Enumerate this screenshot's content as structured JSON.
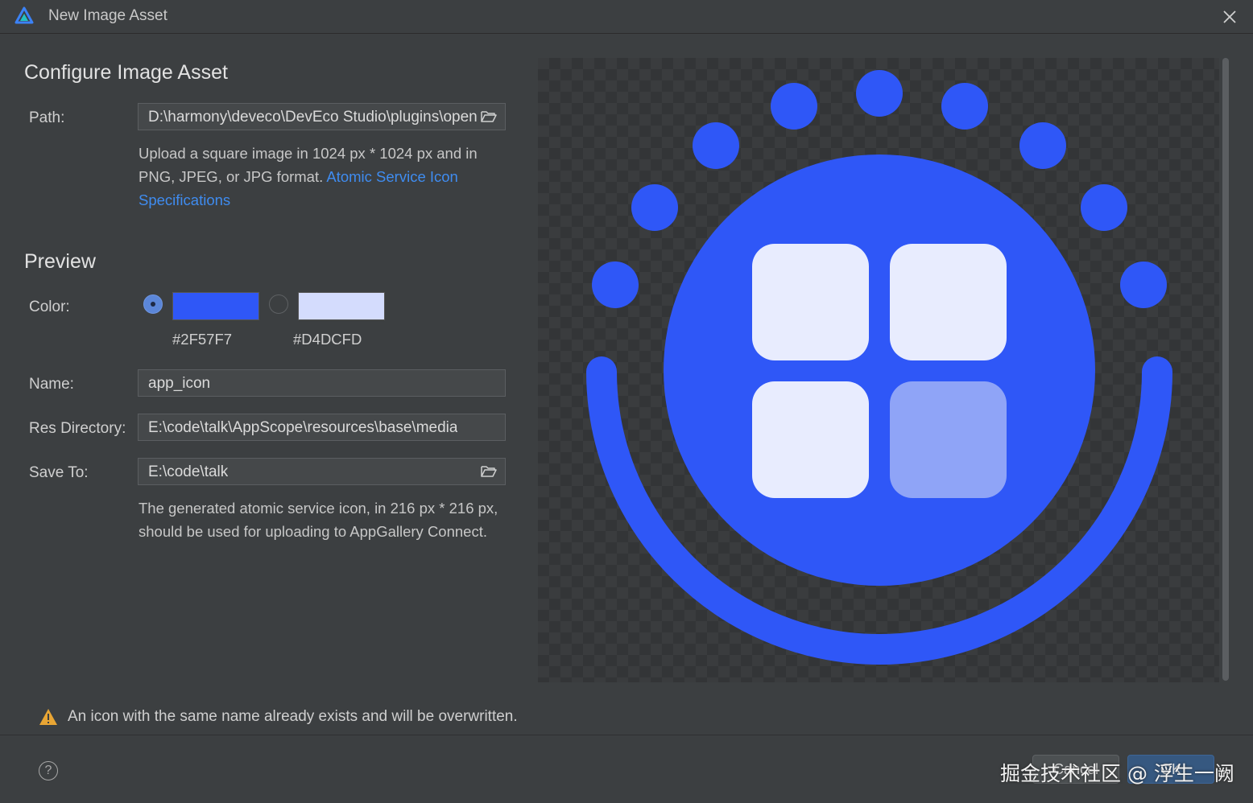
{
  "window": {
    "title": "New Image Asset"
  },
  "configure": {
    "heading": "Configure Image Asset",
    "path_label": "Path:",
    "path_value": "D:\\harmony\\deveco\\DevEco Studio\\plugins\\openharmony",
    "help_text": "Upload a square image in 1024 px * 1024 px and in PNG, JPEG, or JPG format. ",
    "help_link": "Atomic Service Icon Specifications"
  },
  "preview": {
    "heading": "Preview",
    "color_label": "Color:",
    "colors": [
      {
        "hex": "#2F57F7",
        "label": "#2F57F7",
        "selected": true
      },
      {
        "hex": "#D4DCFD",
        "label": "#D4DCFD",
        "selected": false
      }
    ],
    "name_label": "Name:",
    "name_value": "app_icon",
    "res_dir_label": "Res Directory:",
    "res_dir_value": "E:\\code\\talk\\AppScope\\resources\\base\\media",
    "save_to_label": "Save To:",
    "save_to_value": "E:\\code\\talk",
    "save_help": "The generated atomic service icon, in 216 px * 216 px, should be used for uploading to AppGallery Connect."
  },
  "icon_colors": {
    "primary": "#2F57F7",
    "light": "#E8ECFE",
    "dim": "#8FA4F7"
  },
  "warning": {
    "text": "An icon with the same name already exists and will be overwritten.",
    "icon": "warning-triangle-icon"
  },
  "footer": {
    "help_symbol": "?",
    "cancel_label": "Cancel",
    "ok_label": "OK",
    "watermark": "掘金技术社区 @ 浮生一阙"
  }
}
